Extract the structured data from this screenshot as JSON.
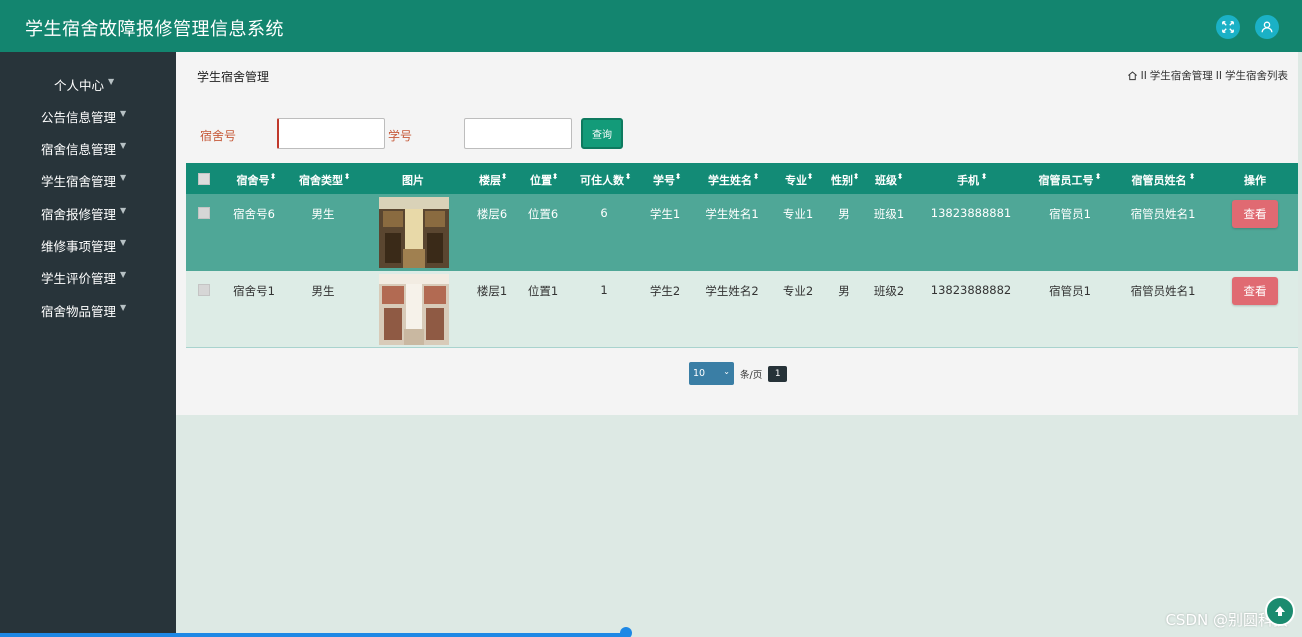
{
  "app": {
    "title": "学生宿舍故障报修管理信息系统"
  },
  "header": {
    "fullscreen_icon": "fullscreen-icon",
    "user_icon": "user-icon"
  },
  "sidebar": {
    "items": [
      {
        "label": "个人中心"
      },
      {
        "label": "公告信息管理"
      },
      {
        "label": "宿舍信息管理"
      },
      {
        "label": "学生宿舍管理"
      },
      {
        "label": "宿舍报修管理"
      },
      {
        "label": "维修事项管理"
      },
      {
        "label": "学生评价管理"
      },
      {
        "label": "宿舍物品管理"
      }
    ]
  },
  "page": {
    "title": "学生宿舍管理",
    "breadcrumb": [
      "学生宿舍管理",
      "学生宿舍列表"
    ],
    "breadcrumb_sep": "II"
  },
  "search": {
    "dorm_label": "宿舍号",
    "dorm_value": "",
    "student_label": "学号",
    "student_value": "",
    "query_label": "查询"
  },
  "table": {
    "headers": [
      "宿舍号",
      "宿舍类型",
      "图片",
      "楼层",
      "位置",
      "可住人数",
      "学号",
      "学生姓名",
      "专业",
      "性别",
      "班级",
      "手机",
      "宿管员工号",
      "宿管员姓名",
      "操作"
    ],
    "rows": [
      {
        "dorm": "宿舍号6",
        "type": "男生",
        "floor": "楼层6",
        "position": "位置6",
        "capacity": "6",
        "student_no": "学生1",
        "student_name": "学生姓名1",
        "major": "专业1",
        "gender": "男",
        "class": "班级1",
        "phone": "13823888881",
        "keeper_no": "宿管员1",
        "keeper_name": "宿管员姓名1",
        "action": "查看"
      },
      {
        "dorm": "宿舍号1",
        "type": "男生",
        "floor": "楼层1",
        "position": "位置1",
        "capacity": "1",
        "student_no": "学生2",
        "student_name": "学生姓名2",
        "major": "专业2",
        "gender": "男",
        "class": "班级2",
        "phone": "13823888882",
        "keeper_no": "宿管员1",
        "keeper_name": "宿管员姓名1",
        "action": "查看"
      }
    ]
  },
  "pagination": {
    "page_size": "10",
    "per_page_label": "条/页",
    "current_page": "1"
  },
  "watermark": "CSDN @别圆科技",
  "colors": {
    "header": "#13856f",
    "sidebar": "#28343a",
    "accent": "#138b76",
    "view_button": "#e06a72"
  }
}
